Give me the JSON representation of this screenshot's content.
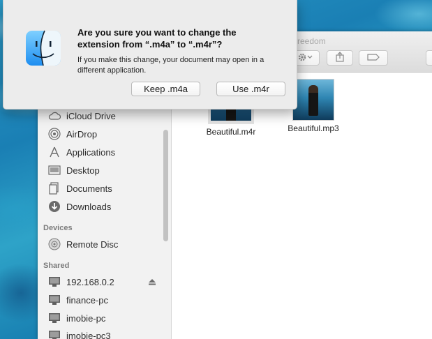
{
  "finder": {
    "title": "reedom",
    "sidebar": {
      "items": [
        {
          "label": "iCloud Drive",
          "icon": "cloud-icon"
        },
        {
          "label": "AirDrop",
          "icon": "airdrop-icon"
        },
        {
          "label": "Applications",
          "icon": "applications-icon"
        },
        {
          "label": "Desktop",
          "icon": "desktop-icon"
        },
        {
          "label": "Documents",
          "icon": "documents-icon"
        },
        {
          "label": "Downloads",
          "icon": "downloads-icon"
        }
      ],
      "devices_header": "Devices",
      "devices": [
        {
          "label": "Remote Disc",
          "icon": "disc-icon"
        }
      ],
      "shared_header": "Shared",
      "shared": [
        {
          "label": "192.168.0.2",
          "icon": "computer-icon"
        },
        {
          "label": "finance-pc",
          "icon": "computer-icon"
        },
        {
          "label": "imobie-pc",
          "icon": "computer-icon"
        },
        {
          "label": "imobie-pc3",
          "icon": "computer-icon"
        }
      ]
    },
    "files": [
      {
        "name": "Beautiful.m4r"
      },
      {
        "name": "Beautiful.mp3"
      }
    ]
  },
  "alert": {
    "title": "Are you sure you want to change the extension from “.m4a” to “.m4r”?",
    "message": "If you make this change, your document may open in a different application.",
    "keep_label": "Keep .m4a",
    "use_label": "Use .m4r"
  },
  "colors": {
    "finder_blue": "#2f7fe0",
    "sidebar_bg": "#f2f2f2",
    "desktop": "#1d7fb0"
  }
}
